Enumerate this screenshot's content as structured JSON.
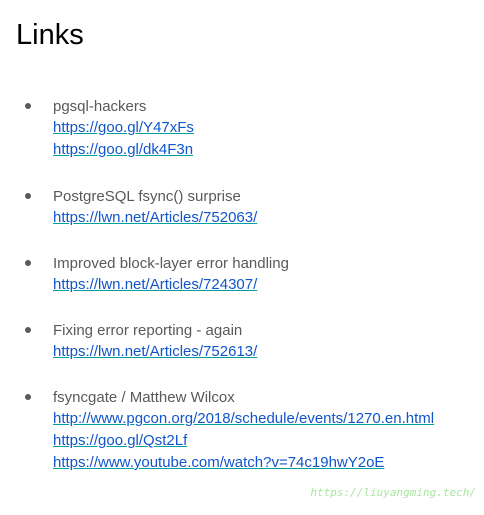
{
  "slide": {
    "title": "Links"
  },
  "items": [
    {
      "text": "pgsql-hackers",
      "links": [
        "https://goo.gl/Y47xFs",
        "https://goo.gl/dk4F3n"
      ]
    },
    {
      "text": "PostgreSQL fsync() surprise",
      "links": [
        "https://lwn.net/Articles/752063/"
      ]
    },
    {
      "text": "Improved block-layer error handling",
      "links": [
        "https://lwn.net/Articles/724307/"
      ]
    },
    {
      "text": "Fixing error reporting - again",
      "links": [
        "https://lwn.net/Articles/752613/"
      ]
    },
    {
      "text": "fsyncgate / Matthew Wilcox",
      "links": [
        "http://www.pgcon.org/2018/schedule/events/1270.en.html",
        "https://goo.gl/Qst2Lf",
        "https://www.youtube.com/watch?v=74c19hwY2oE"
      ]
    }
  ],
  "watermark": "https://liuyangming.tech/",
  "colors": {
    "link": "#1155cc",
    "link_underline": "#00a0a0",
    "body_text": "#595959",
    "watermark": "#a8e6a0"
  }
}
